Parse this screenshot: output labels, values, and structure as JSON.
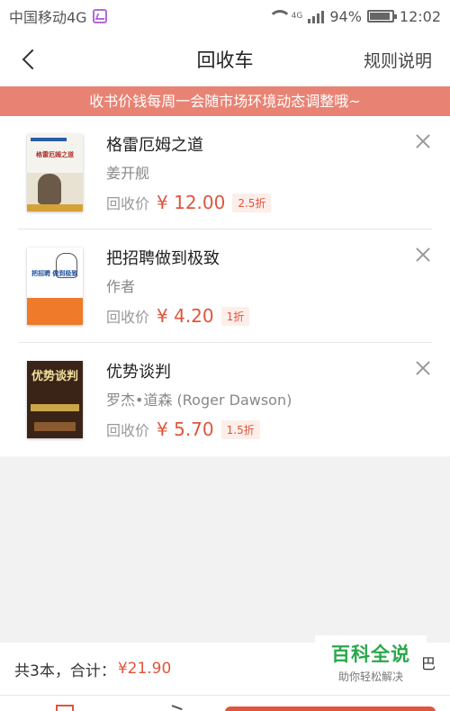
{
  "status_bar": {
    "carrier": "中国移动4G",
    "net_label": "4G",
    "battery": "94%",
    "time": "12:02"
  },
  "nav": {
    "title": "回收车",
    "rules_label": "规则说明",
    "back_icon": "chevron-left-icon"
  },
  "notice": "收书价钱每周一会随市场环境动态调整哦~",
  "items": [
    {
      "title": "格雷厄姆之道",
      "author": "姜开舰",
      "price_label": "回收价",
      "price": "¥ 12.00",
      "discount": "2.5折",
      "cover_text": "格雷厄姆之道"
    },
    {
      "title": "把招聘做到极致",
      "author": "作者",
      "price_label": "回收价",
      "price": "¥ 4.20",
      "discount": "1折",
      "cover_text": "把招聘 做到极致"
    },
    {
      "title": "优势谈判",
      "author": "罗杰•道森 (Roger Dawson)",
      "price_label": "回收价",
      "price": "¥ 5.70",
      "discount": "1.5折",
      "cover_text": "优势谈判"
    }
  ],
  "bottom": {
    "summary_label": "共3本，合计：",
    "total": "¥21.90"
  },
  "watermark": {
    "title": "百科全说",
    "subtitle": "助你轻松解决",
    "edge_char": "巴"
  },
  "colors": {
    "accent": "#e0553b",
    "notice_bg": "#e88374",
    "watermark_green": "#2aa84a"
  }
}
